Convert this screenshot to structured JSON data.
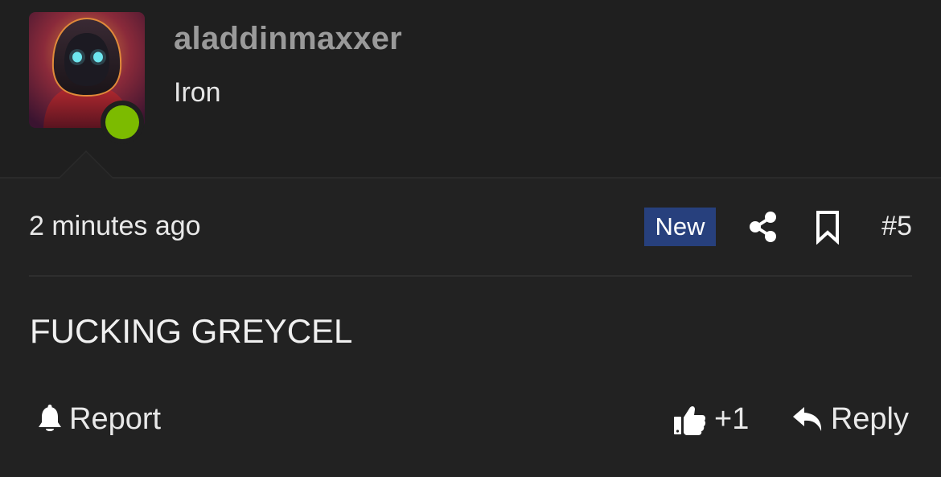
{
  "user": {
    "username": "aladdinmaxxer",
    "title": "Iron",
    "avatar_icon": "hooded-robot-avatar",
    "online_status_color": "#7cbb00"
  },
  "post": {
    "timestamp": "2 minutes ago",
    "badge": "New",
    "badge_color": "#27407d",
    "number": "#5",
    "message": "FUCKING GREYCEL"
  },
  "icons": {
    "share": "share-icon",
    "bookmark": "bookmark-icon",
    "report": "bell-icon",
    "like": "thumbs-up-icon",
    "reply": "reply-arrow-icon"
  },
  "actions": {
    "report_label": "Report",
    "like_label": "+1",
    "reply_label": "Reply"
  }
}
